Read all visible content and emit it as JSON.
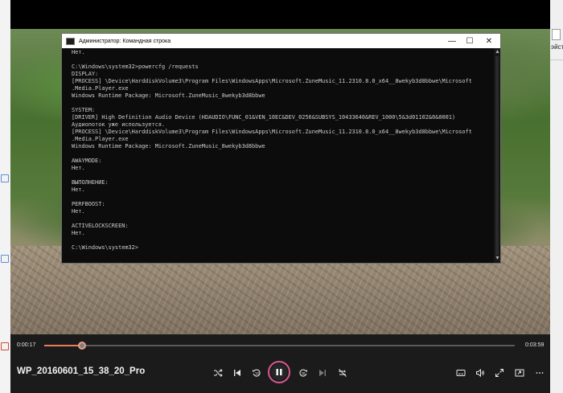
{
  "cmd": {
    "title": "Администратор: Командная строка",
    "lines": [
      "Нет.",
      "",
      "C:\\Windows\\system32>powercfg /requests",
      "DISPLAY:",
      "[PROCESS] \\Device\\HarddiskVolume3\\Program Files\\WindowsApps\\Microsoft.ZuneMusic_11.2310.8.0_x64__8wekyb3d8bbwe\\Microsoft",
      ".Media.Player.exe",
      "Windows Runtime Package: Microsoft.ZuneMusic_8wekyb3d8bbwe",
      "",
      "SYSTEM:",
      "[DRIVER] High Definition Audio Device (HDAUDIO\\FUNC_01&VEN_10EC&DEV_0256&SUBSYS_10433640&REV_1000\\5&3d01102&0&0001)",
      "Аудиопоток уже используется.",
      "[PROCESS] \\Device\\HarddiskVolume3\\Program Files\\WindowsApps\\Microsoft.ZuneMusic_11.2310.8.0_x64__8wekyb3d8bbwe\\Microsoft",
      ".Media.Player.exe",
      "Windows Runtime Package: Microsoft.ZuneMusic_8wekyb3d8bbwe",
      "",
      "AWAYMODE:",
      "Нет.",
      "",
      "ВЫПОЛНЕНИЕ:",
      "Нет.",
      "",
      "PERFBOOST:",
      "Нет.",
      "",
      "ACTIVELOCKSCREEN:",
      "Нет.",
      "",
      "C:\\Windows\\system32>"
    ],
    "buttons": {
      "minimize": "—",
      "maximize": "☐",
      "close": "✕"
    }
  },
  "player": {
    "title": "WP_20160601_15_38_20_Pro",
    "current_time": "0:00:17",
    "total_time": "0:03:59",
    "progress_fraction": 0.08,
    "accent_color": "#e77d5c",
    "ring_color": "#d9588f",
    "controls_left": [
      "shuffle-icon",
      "previous-icon",
      "rewind-10-icon",
      "pause-icon",
      "forward-30-icon",
      "next-icon",
      "repeat-off-icon"
    ],
    "controls_right": [
      "subtitles-icon",
      "volume-icon",
      "fullscreen-icon",
      "miniplayer-icon",
      "more-icon"
    ]
  },
  "desktop": {
    "right_snippet": "эйства"
  }
}
